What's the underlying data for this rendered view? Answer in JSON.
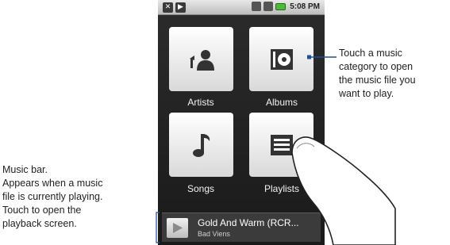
{
  "status_bar": {
    "time": "5:08 PM",
    "left_icons": [
      "notification-icon",
      "media-icon"
    ],
    "right_icons": [
      "network-icon",
      "signal-icon",
      "battery-icon"
    ]
  },
  "tiles": [
    {
      "label": "Artists",
      "icon": "artist-icon"
    },
    {
      "label": "Albums",
      "icon": "album-icon"
    },
    {
      "label": "Songs",
      "icon": "music-note-icon"
    },
    {
      "label": "Playlists",
      "icon": "playlist-icon"
    }
  ],
  "music_bar": {
    "title": "Gold And Warm (RCR...",
    "artist": "Bad Viens"
  },
  "callouts": {
    "category_lines": [
      "Touch a music",
      "category to open",
      "the music file you",
      "want to play."
    ],
    "music_bar_lines": [
      "Music bar.",
      "Appears when a music",
      "file is currently playing.",
      "Touch to open the",
      "playback screen."
    ]
  },
  "colors": {
    "screen_background": "#1e1e1e",
    "tile": "#f5f5f5",
    "battery": "#4cbb3a",
    "leader_line": "#1f4e9c"
  }
}
